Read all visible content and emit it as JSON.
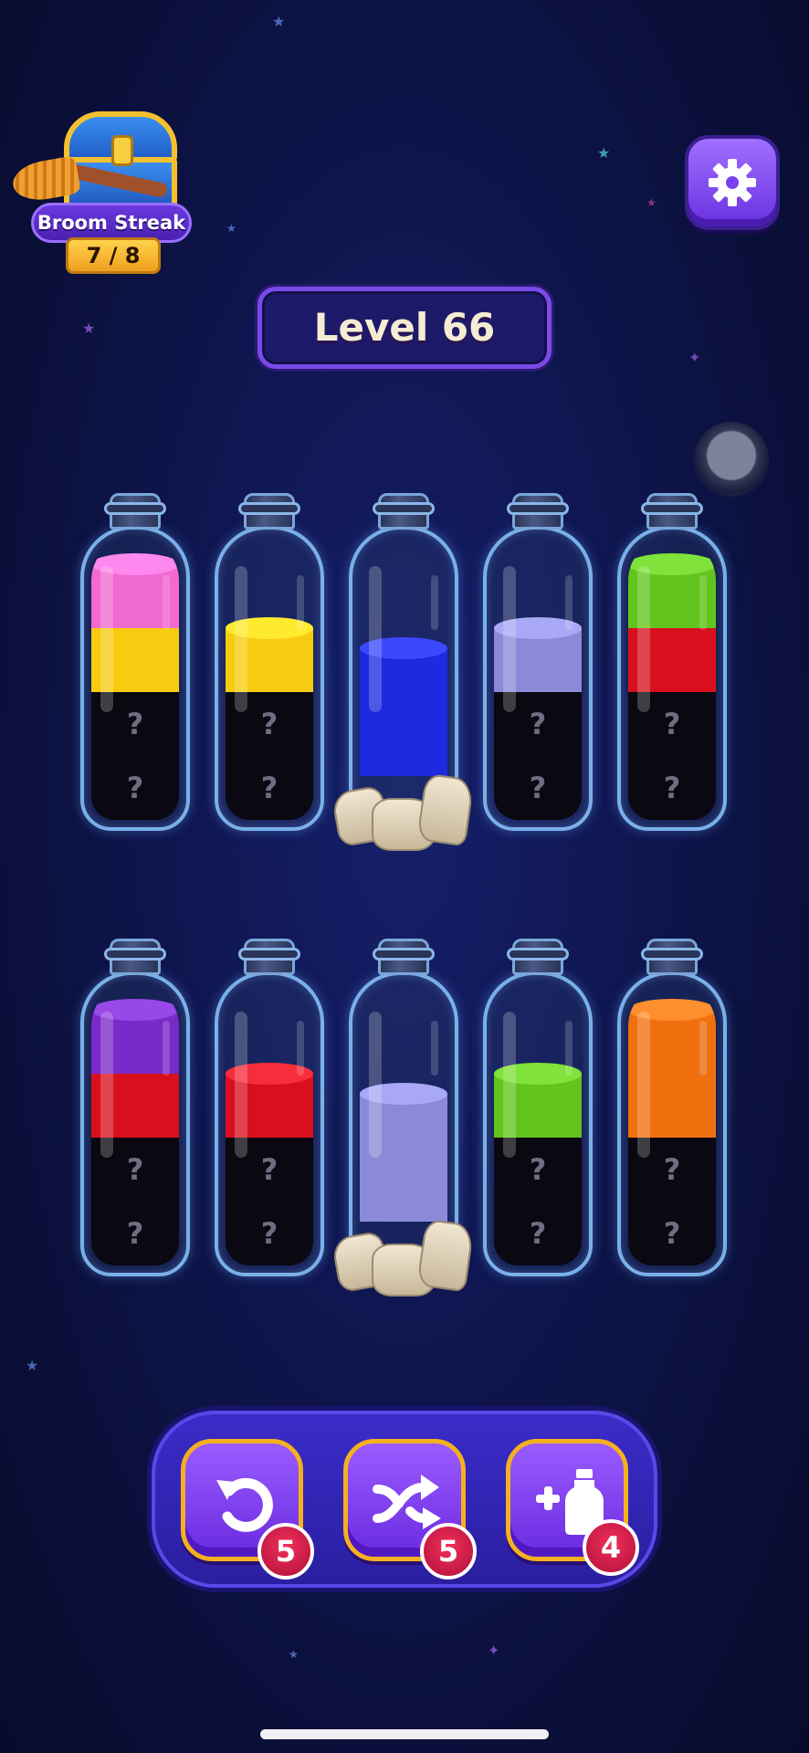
{
  "streak": {
    "title": "Broom Streak",
    "progress": "7 / 8"
  },
  "level": {
    "label": "Level 66"
  },
  "settings": {
    "icon": "gear-icon"
  },
  "colors": {
    "pink": "#f06ad0",
    "yellow": "#f7cc10",
    "blue": "#1e2ae0",
    "lavender": "#8a8ad8",
    "green": "#62c41c",
    "red": "#d8101e",
    "purple": "#7a2ac8",
    "orange": "#f07010",
    "hidden": "#0a0810"
  },
  "bottles_row1": [
    {
      "layers_bottom_to_top": [
        "hidden",
        "hidden",
        "yellow",
        "pink"
      ],
      "hidden_marks": [
        "?",
        "?"
      ]
    },
    {
      "layers_bottom_to_top": [
        "hidden",
        "hidden",
        "yellow"
      ],
      "hidden_marks": [
        "?",
        "?"
      ]
    },
    {
      "layers_bottom_to_top": [
        "blue",
        "blue"
      ],
      "rock_base": true
    },
    {
      "layers_bottom_to_top": [
        "hidden",
        "hidden",
        "lavender"
      ],
      "hidden_marks": [
        "?",
        "?"
      ]
    },
    {
      "layers_bottom_to_top": [
        "hidden",
        "hidden",
        "red",
        "green"
      ],
      "hidden_marks": [
        "?",
        "?"
      ]
    }
  ],
  "bottles_row2": [
    {
      "layers_bottom_to_top": [
        "hidden",
        "hidden",
        "red",
        "purple"
      ],
      "hidden_marks": [
        "?",
        "?"
      ]
    },
    {
      "layers_bottom_to_top": [
        "hidden",
        "hidden",
        "red"
      ],
      "hidden_marks": [
        "?",
        "?"
      ]
    },
    {
      "layers_bottom_to_top": [
        "lavender",
        "lavender"
      ],
      "rock_base": true
    },
    {
      "layers_bottom_to_top": [
        "hidden",
        "hidden",
        "green"
      ],
      "hidden_marks": [
        "?",
        "?"
      ]
    },
    {
      "layers_bottom_to_top": [
        "hidden",
        "hidden",
        "orange",
        "orange"
      ],
      "hidden_marks": [
        "?",
        "?"
      ]
    }
  ],
  "tools": {
    "undo": {
      "icon": "undo-icon",
      "count": "5"
    },
    "shuffle": {
      "icon": "shuffle-icon",
      "count": "5"
    },
    "add_bottle": {
      "icon": "add-bottle-icon",
      "count": "4"
    }
  }
}
